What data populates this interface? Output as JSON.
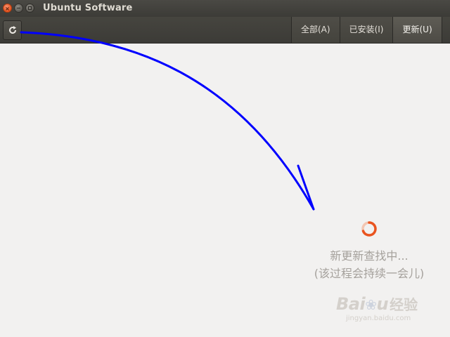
{
  "window": {
    "title": "Ubuntu Software",
    "close_glyph": "×"
  },
  "toolbar": {
    "refresh_icon": "refresh-icon",
    "tabs": [
      {
        "label": "全部(A)"
      },
      {
        "label": "已安装(I)"
      },
      {
        "label": "更新(U)"
      }
    ]
  },
  "main": {
    "status_line1": "新更新查找中...",
    "status_line2": "(该过程会持续一会儿)"
  },
  "watermark": {
    "logo_prefix": "Bai",
    "logo_suffix": "u",
    "logo_paw": "❀",
    "brand_cn": "经验",
    "url": "jingyan.baidu.com"
  },
  "colors": {
    "accent_spinner": "#e9541f",
    "annotation_arrow": "#0000ff",
    "titlebar": "#3c3b37",
    "background": "#f2f1f0"
  }
}
